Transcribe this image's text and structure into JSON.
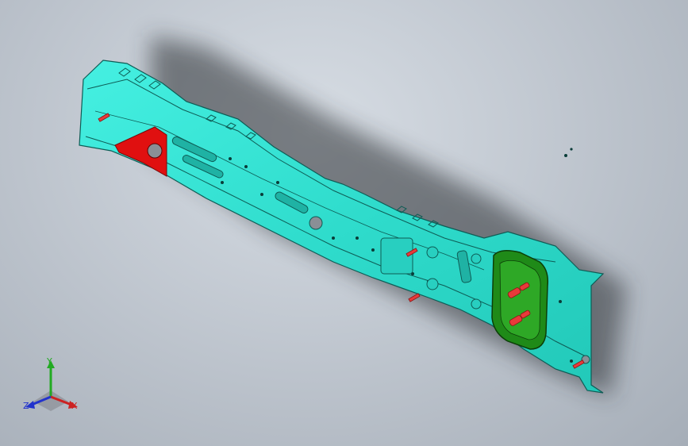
{
  "viewport": {
    "part_color": "#32e6d6",
    "part_edge_color": "#0e5c55",
    "highlight_red": "#e01010",
    "highlight_green": "#1f8a18",
    "pin_color": "#e83a3a"
  },
  "triad": {
    "y_label": "Y",
    "x_label": "X",
    "z_label": "Z",
    "y_color": "#22aa22",
    "x_color": "#cc2222",
    "z_color": "#2233cc"
  }
}
